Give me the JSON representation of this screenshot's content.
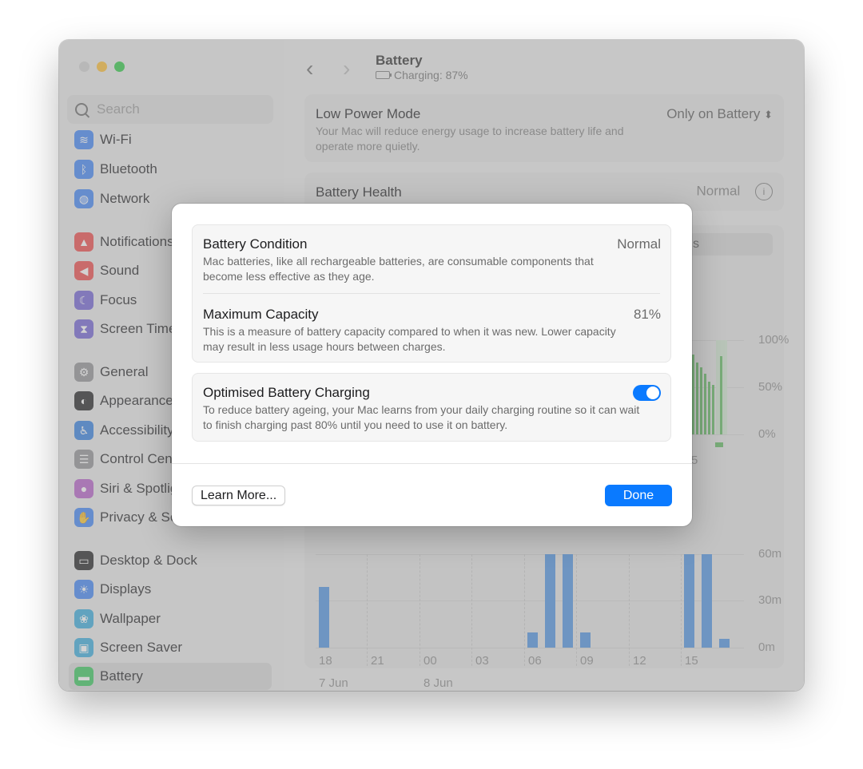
{
  "window": {
    "title": "Battery",
    "subtitle": "Charging: 87%"
  },
  "sidebar": {
    "search_placeholder": "Search",
    "items": [
      {
        "label": "Wi-Fi",
        "icon": "wifi-icon",
        "color": "#3b82f6"
      },
      {
        "label": "Bluetooth",
        "icon": "bluetooth-icon",
        "color": "#3b82f6"
      },
      {
        "label": "Network",
        "icon": "globe-icon",
        "color": "#3b82f6"
      },
      {
        "label": "Notifications",
        "icon": "bell-icon",
        "color": "#ef4444"
      },
      {
        "label": "Sound",
        "icon": "speaker-icon",
        "color": "#ef4444"
      },
      {
        "label": "Focus",
        "icon": "moon-icon",
        "color": "#6d5dd3"
      },
      {
        "label": "Screen Time",
        "icon": "hourglass-icon",
        "color": "#6d5dd3"
      },
      {
        "label": "General",
        "icon": "gear-icon",
        "color": "#8e8e93"
      },
      {
        "label": "Appearance",
        "icon": "appearance-icon",
        "color": "#1c1c1e"
      },
      {
        "label": "Accessibility",
        "icon": "accessibility-icon",
        "color": "#2f7de1"
      },
      {
        "label": "Control Centre",
        "icon": "control-centre-icon",
        "color": "#8e8e93"
      },
      {
        "label": "Siri & Spotlight",
        "icon": "siri-icon",
        "color": "#b45cc9"
      },
      {
        "label": "Privacy & Security",
        "icon": "hand-icon",
        "color": "#3b82f6"
      },
      {
        "label": "Desktop & Dock",
        "icon": "dock-icon",
        "color": "#1c1c1e"
      },
      {
        "label": "Displays",
        "icon": "sun-icon",
        "color": "#3b82f6"
      },
      {
        "label": "Wallpaper",
        "icon": "flower-icon",
        "color": "#34aadc"
      },
      {
        "label": "Screen Saver",
        "icon": "screen-saver-icon",
        "color": "#34aadc"
      },
      {
        "label": "Battery",
        "icon": "battery-icon",
        "color": "#34c759"
      }
    ]
  },
  "main": {
    "low_power": {
      "title": "Low Power Mode",
      "desc": "Your Mac will reduce energy usage to increase battery life and operate more quietly.",
      "value": "Only on Battery"
    },
    "battery_health": {
      "title": "Battery Health",
      "value": "Normal"
    }
  },
  "chart_data": [
    {
      "type": "bar",
      "title": "",
      "y_ticks": [
        "100%",
        "50%",
        "0%"
      ],
      "series": [
        {
          "values": [
            88,
            83,
            78,
            70,
            55,
            93
          ]
        }
      ]
    },
    {
      "type": "bar",
      "title": "",
      "x": [
        "18",
        "21",
        "00",
        "03",
        "06",
        "09",
        "12",
        "15"
      ],
      "date_labels": [
        "7 Jun",
        "8 Jun"
      ],
      "y_ticks": [
        "60m",
        "30m",
        "0m"
      ],
      "series": [
        {
          "values": [
            38,
            0,
            0,
            0,
            0,
            0,
            0,
            10,
            60,
            60,
            10,
            0,
            0,
            0,
            0,
            60,
            60,
            5
          ]
        }
      ]
    }
  ],
  "sheet": {
    "condition_title": "Battery Condition",
    "condition_value": "Normal",
    "condition_desc": "Mac batteries, like all rechargeable batteries, are consumable components that become less effective as they age.",
    "capacity_title": "Maximum Capacity",
    "capacity_value": "81%",
    "capacity_desc": "This is a measure of battery capacity compared to when it was new. Lower capacity may result in less usage hours between charges.",
    "optimised_title": "Optimised Battery Charging",
    "optimised_desc": "To reduce battery ageing, your Mac learns from your daily charging routine so it can wait to finish charging past 80% until you need to use it on battery.",
    "optimised_on": true,
    "learn_more": "Learn More...",
    "done": "Done"
  }
}
